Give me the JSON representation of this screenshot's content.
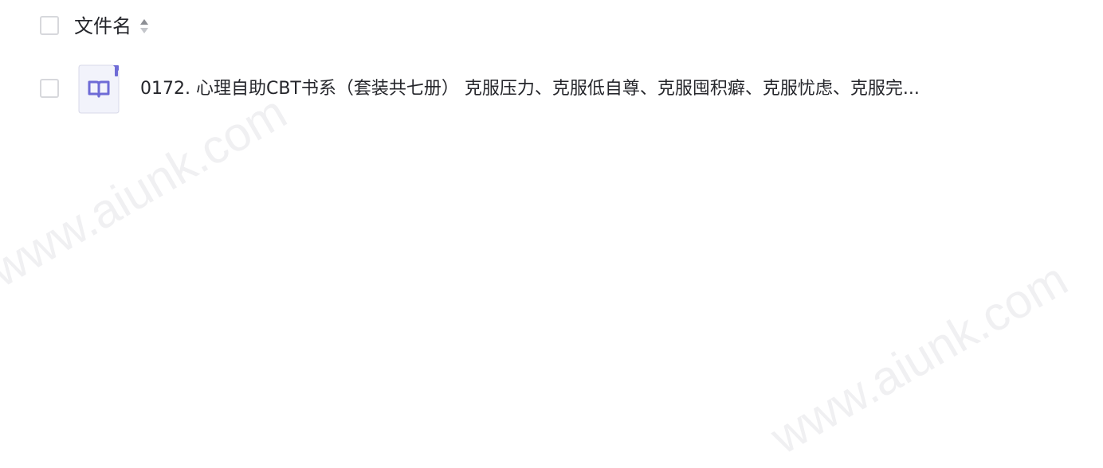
{
  "list_header": {
    "select_all_checked": false,
    "column_title": "文件名",
    "sort_icon": "sort-updown-icon"
  },
  "files": [
    {
      "checked": false,
      "icon": "ebook-icon",
      "name": "0172. 心理自助CBT书系（套装共七册） 克服压力、克服低自尊、克服囤积癖、克服忧虑、克服完..."
    }
  ],
  "watermarks": [
    "www.aiunk.com",
    "www.aiunk.com"
  ],
  "colors": {
    "text": "#25262b",
    "checkbox_border": "#d7d8dc",
    "icon_accent": "#6e6bd6",
    "icon_bg": "#f2f3fb",
    "watermark": "#b4b6bc"
  }
}
